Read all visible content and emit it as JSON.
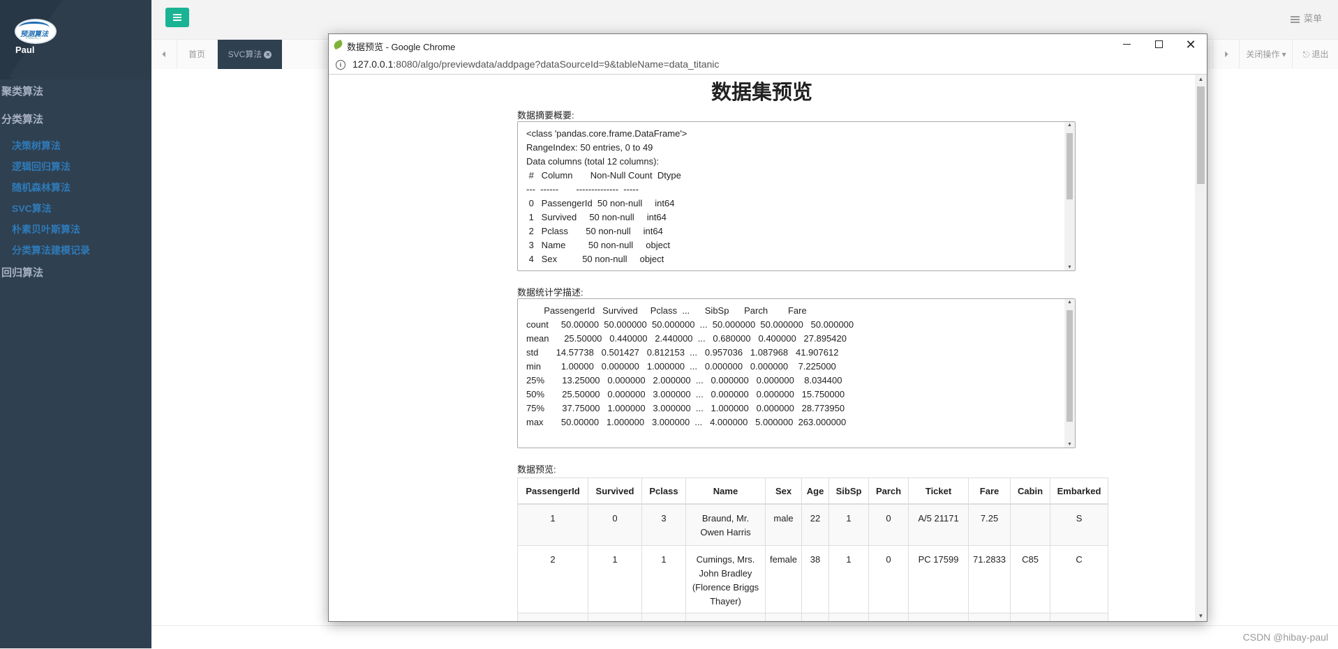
{
  "sidebar": {
    "logo_text": "预测算法",
    "user_name": "Paul",
    "groups": [
      {
        "label": "聚类算法"
      },
      {
        "label": "分类算法"
      }
    ],
    "subitems": [
      {
        "label": "决策树算法"
      },
      {
        "label": "逻辑回归算法"
      },
      {
        "label": "随机森林算法"
      },
      {
        "label": "SVC算法"
      },
      {
        "label": "朴素贝叶斯算法"
      },
      {
        "label": "分类算法建模记录"
      }
    ],
    "last_group": "回归算法"
  },
  "topbar": {
    "menu_label": "菜单"
  },
  "tabs": {
    "home": "首页",
    "active": "SVC算法",
    "close_ops": "关闭操作",
    "logout": "退出"
  },
  "footer": {
    "watermark": "CSDN @hibay-paul"
  },
  "window": {
    "title": "数据预览 - Google Chrome",
    "url_host": "127.0.0.1",
    "url_rest": ":8080/algo/previewdata/addpage?dataSourceId=9&tableName=data_titanic"
  },
  "page": {
    "title": "数据集预览",
    "summary_label": "数据摘要概要:",
    "summary_text": "<class 'pandas.core.frame.DataFrame'>\nRangeIndex: 50 entries, 0 to 49\nData columns (total 12 columns):\n #   Column       Non-Null Count  Dtype\n---  ------       --------------  -----\n 0   PassengerId  50 non-null     int64\n 1   Survived     50 non-null     int64\n 2   Pclass       50 non-null     int64\n 3   Name         50 non-null     object\n 4   Sex          50 non-null     object",
    "stats_label": "数据统计学描述:",
    "stats_text": "       PassengerId   Survived     Pclass  ...      SibSp      Parch        Fare\ncount     50.00000  50.000000  50.000000  ...  50.000000  50.000000   50.000000\nmean      25.50000   0.440000   2.440000  ...   0.680000   0.400000   27.895420\nstd       14.57738   0.501427   0.812153  ...   0.957036   1.087968   41.907612\nmin        1.00000   0.000000   1.000000  ...   0.000000   0.000000    7.225000\n25%       13.25000   0.000000   2.000000  ...   0.000000   0.000000    8.034400\n50%       25.50000   0.000000   3.000000  ...   0.000000   0.000000   15.750000\n75%       37.75000   1.000000   3.000000  ...   1.000000   0.000000   28.773950\nmax       50.00000   1.000000   3.000000  ...   4.000000   5.000000  263.000000",
    "preview_label": "数据预览:",
    "table": {
      "headers": [
        "PassengerId",
        "Survived",
        "Pclass",
        "Name",
        "Sex",
        "Age",
        "SibSp",
        "Parch",
        "Ticket",
        "Fare",
        "Cabin",
        "Embarked"
      ],
      "rows": [
        [
          "1",
          "0",
          "3",
          "Braund, Mr. Owen Harris",
          "male",
          "22",
          "1",
          "0",
          "A/5 21171",
          "7.25",
          "",
          "S"
        ],
        [
          "2",
          "1",
          "1",
          "Cumings, Mrs. John Bradley (Florence Briggs Thayer)",
          "female",
          "38",
          "1",
          "0",
          "PC 17599",
          "71.2833",
          "C85",
          "C"
        ],
        [
          "",
          "",
          "",
          "",
          "",
          "",
          "",
          "",
          "",
          "",
          "",
          ""
        ]
      ]
    }
  }
}
